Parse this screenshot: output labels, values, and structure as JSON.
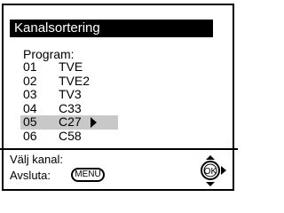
{
  "title": "Kanalsortering",
  "program_label": "Program:",
  "channels": [
    {
      "number": "01",
      "name": "TVE"
    },
    {
      "number": "02",
      "name": "TVE2"
    },
    {
      "number": "03",
      "name": "TV3"
    },
    {
      "number": "04",
      "name": "C33"
    },
    {
      "number": "05",
      "name": "C27"
    },
    {
      "number": "06",
      "name": "C58"
    }
  ],
  "selected_index": 4,
  "footer": {
    "select_label": "Välj kanal:",
    "exit_label": "Avsluta:",
    "menu_button": "MENU",
    "ok_button": "OK"
  },
  "colors": {
    "title_bg": "#000000",
    "selected_row_bg": "#c8c8c8"
  }
}
